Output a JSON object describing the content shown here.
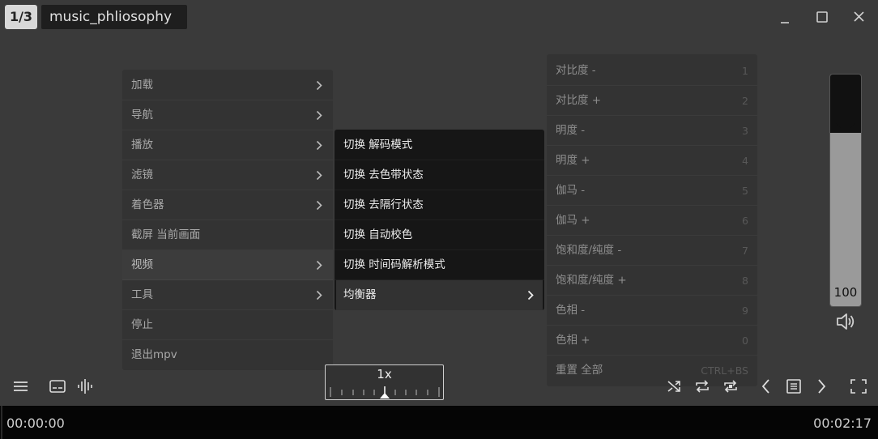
{
  "header": {
    "playlist_counter": "1/3",
    "title": "music_phliosophy"
  },
  "colors": {
    "background": "#3a3a3a",
    "menu_bg": "#333333",
    "submenu_bg": "#161616",
    "bottom_bar": "#050505"
  },
  "main_menu": {
    "items": [
      {
        "label": "加载",
        "submenu": true
      },
      {
        "label": "导航",
        "submenu": true
      },
      {
        "label": "播放",
        "submenu": true
      },
      {
        "label": "滤镜",
        "submenu": true
      },
      {
        "label": "着色器",
        "submenu": true
      },
      {
        "label": "截屏 当前画面",
        "submenu": false
      },
      {
        "label": "视频",
        "submenu": true
      },
      {
        "label": "工具",
        "submenu": true
      },
      {
        "label": "停止",
        "submenu": false
      },
      {
        "label": "退出mpv",
        "submenu": false
      }
    ]
  },
  "video_menu": {
    "items": [
      {
        "label": "切换 解码模式"
      },
      {
        "label": "切换 去色带状态"
      },
      {
        "label": "切换 去隔行状态"
      },
      {
        "label": "切换 自动校色"
      },
      {
        "label": "切换 时间码解析模式"
      },
      {
        "label": "均衡器"
      }
    ]
  },
  "equalizer_menu": {
    "items": [
      {
        "label": "对比度 -",
        "key": "1"
      },
      {
        "label": "对比度 +",
        "key": "2"
      },
      {
        "label": "明度 -",
        "key": "3"
      },
      {
        "label": "明度 +",
        "key": "4"
      },
      {
        "label": "伽马 -",
        "key": "5"
      },
      {
        "label": "伽马 +",
        "key": "6"
      },
      {
        "label": "饱和度/纯度 -",
        "key": "7"
      },
      {
        "label": "饱和度/纯度 +",
        "key": "8"
      },
      {
        "label": "色相 -",
        "key": "9"
      },
      {
        "label": "色相 +",
        "key": "0"
      },
      {
        "label": "重置 全部",
        "key": "CTRL+BS"
      }
    ]
  },
  "volume": {
    "value": "100",
    "level": 1.0
  },
  "speed": {
    "label": "1x"
  },
  "timeline": {
    "elapsed": "00:00:00",
    "total": "00:02:17"
  },
  "icons": {
    "left_controls": [
      "menu-icon",
      "subtitles-icon",
      "audio-waveform-icon"
    ],
    "right_controls": [
      "shuffle-icon",
      "loop-playlist-icon",
      "loop-file-icon",
      "prev-icon",
      "playlist-icon",
      "next-icon",
      "fullscreen-icon"
    ],
    "window": [
      "minimize-icon",
      "maximize-icon",
      "close-icon"
    ]
  }
}
